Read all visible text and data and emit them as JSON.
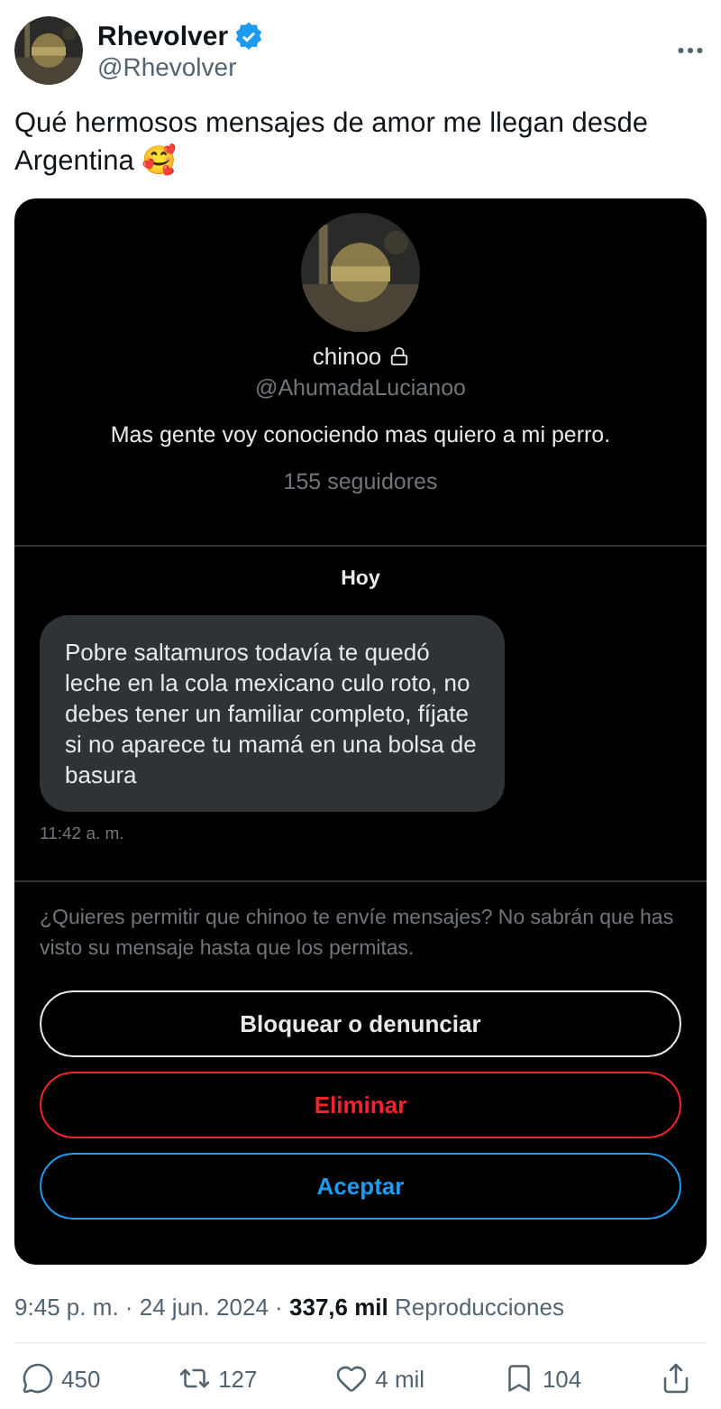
{
  "author": {
    "name": "Rhevolver",
    "handle": "@Rhevolver",
    "verified": true
  },
  "tweet_text": "Qué hermosos mensajes de amor me llegan desde Argentina 🥰",
  "dm_card": {
    "profile": {
      "name": "chinoo",
      "protected": true,
      "handle": "@AhumadaLucianoo",
      "bio": "Mas gente voy conociendo mas quiero a mi perro.",
      "followers": "155 seguidores"
    },
    "date_separator": "Hoy",
    "messages": [
      {
        "text": "Pobre saltamuros todavía te quedó leche en la cola mexicano culo roto, no debes tener un familiar completo, fíjate si no aparece tu mamá en una bolsa de basura",
        "time": "11:42 a. m."
      }
    ],
    "request_prompt": "¿Quieres permitir que chinoo te envíe mensajes? No sabrán que has visto su mensaje hasta que los permitas.",
    "buttons": [
      {
        "label": "Bloquear o denunciar",
        "kind": "neutral"
      },
      {
        "label": "Eliminar",
        "kind": "danger"
      },
      {
        "label": "Aceptar",
        "kind": "primary"
      }
    ]
  },
  "meta": "9:45 p. m. · 24 jun. 2024 · **337,6 mil** Reproducciones",
  "actions": [
    {
      "kind": "reply",
      "count": "450"
    },
    {
      "kind": "repost",
      "count": "127"
    },
    {
      "kind": "like",
      "count": "4 mil"
    },
    {
      "kind": "bookmark",
      "count": "104"
    },
    {
      "kind": "share"
    }
  ]
}
